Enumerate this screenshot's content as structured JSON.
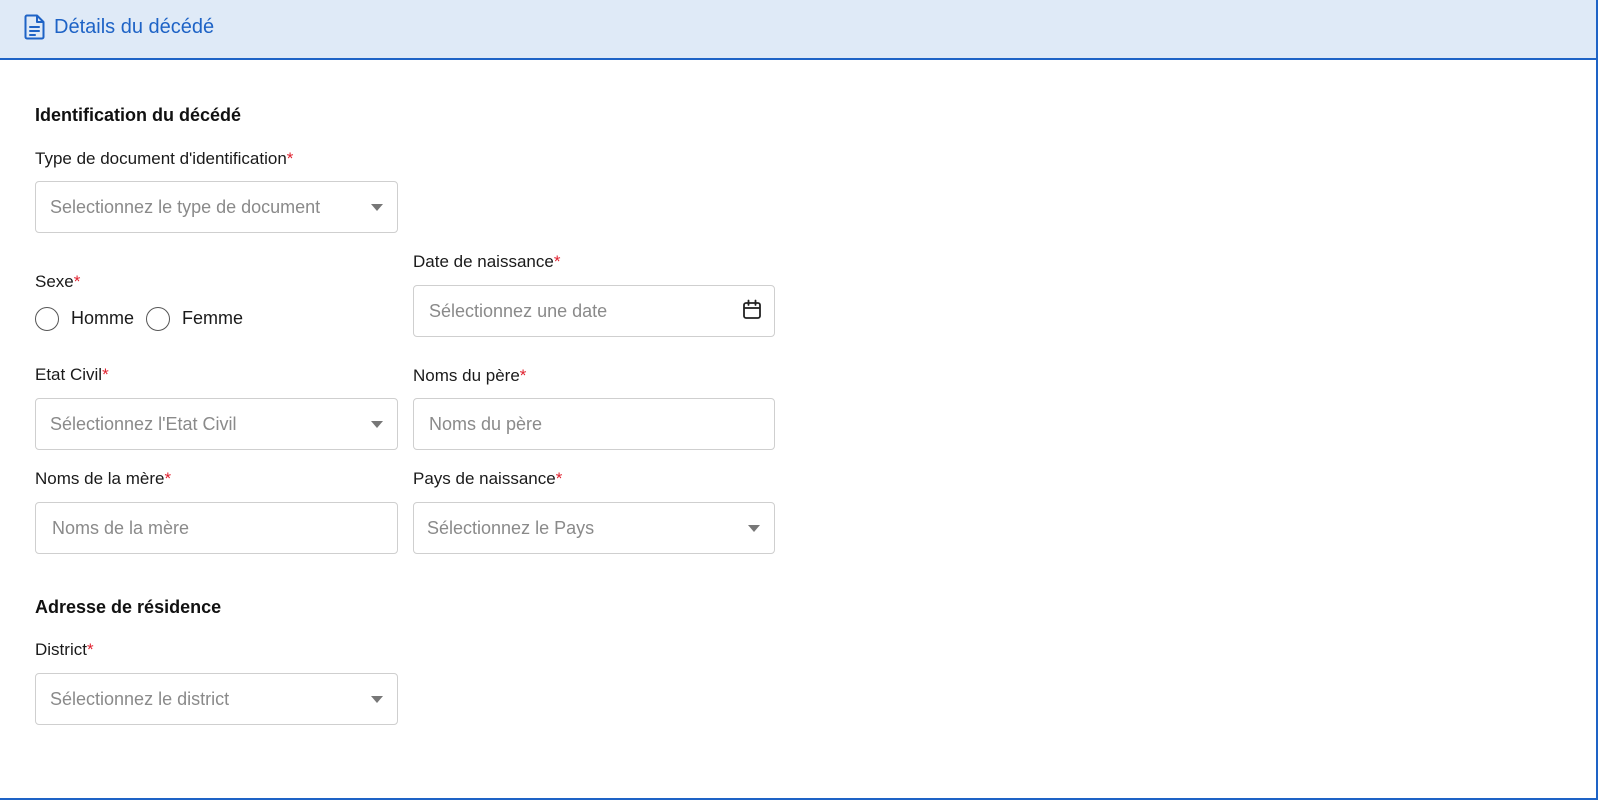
{
  "header": {
    "title": "Détails du décédé",
    "icon": "document-icon",
    "accent_color": "#1e63c6",
    "background_color": "#dfeaf7"
  },
  "identification": {
    "section_title": "Identification du décédé",
    "document_type": {
      "label": "Type de document d'identification",
      "required_mark": "*",
      "placeholder": "Selectionnez le type de document"
    },
    "sex": {
      "label": "Sexe",
      "required_mark": "*",
      "options": [
        "Homme",
        "Femme"
      ]
    },
    "birth_date": {
      "label": "Date de naissance",
      "required_mark": "*",
      "placeholder": "Sélectionnez une date",
      "icon": "calendar-icon"
    },
    "civil_status": {
      "label": "Etat Civil",
      "required_mark": "*",
      "placeholder": "Sélectionnez l'Etat Civil"
    },
    "father_names": {
      "label": "Noms du père",
      "required_mark": "*",
      "placeholder": "Noms du père"
    },
    "mother_names": {
      "label": "Noms de la mère",
      "required_mark": "*",
      "placeholder": "Noms de la mère"
    },
    "birth_country": {
      "label": "Pays de naissance",
      "required_mark": "*",
      "placeholder": "Sélectionnez le Pays"
    }
  },
  "residence": {
    "section_title": "Adresse de résidence",
    "district": {
      "label": "District",
      "required_mark": "*",
      "placeholder": "Sélectionnez le district"
    }
  },
  "colors": {
    "required": "#e0202e",
    "placeholder": "#8a8a8a",
    "border": "#cfcfcf"
  }
}
